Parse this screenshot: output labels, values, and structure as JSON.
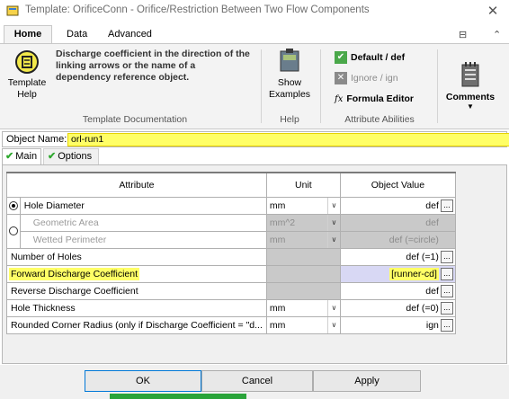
{
  "window": {
    "title": "Template: OrificeConn - Orifice/Restriction Between Two Flow Components"
  },
  "ribbon_tabs": [
    "Home",
    "Data",
    "Advanced"
  ],
  "ribbon": {
    "template_help_label": "Template Help",
    "description": "Discharge coefficient in the direction of the linking arrows or the name of a dependency reference object.",
    "group_template_documentation": "Template Documentation",
    "show_examples_label": "Show Examples",
    "group_help": "Help",
    "default_label": "Default / def",
    "ignore_label": "Ignore / ign",
    "formula_editor_label": "Formula Editor",
    "group_attribute_abilities": "Attribute Abilities",
    "comments_label": "Comments"
  },
  "object_name": {
    "label": "Object Name:",
    "value": "orl-run1"
  },
  "subtabs": [
    "Main",
    "Options"
  ],
  "grid": {
    "headers": [
      "Attribute",
      "Unit",
      "Object Value"
    ],
    "rows": [
      {
        "attribute": "Hole Diameter",
        "unit": "mm",
        "value": "def"
      },
      {
        "attribute": "Geometric Area",
        "unit": "mm^2",
        "value": "def"
      },
      {
        "attribute": "Wetted Perimeter",
        "unit": "mm",
        "value": "def (=circle)"
      },
      {
        "attribute": "Number of Holes",
        "unit": "",
        "value": "def (=1)"
      },
      {
        "attribute": "Forward Discharge Coefficient",
        "unit": "",
        "value": "[runner-cd]"
      },
      {
        "attribute": "Reverse Discharge Coefficient",
        "unit": "",
        "value": "def"
      },
      {
        "attribute": "Hole Thickness",
        "unit": "mm",
        "value": "def (=0)"
      },
      {
        "attribute": "Rounded Corner Radius (only if Discharge Coefficient = \"d...",
        "unit": "mm",
        "value": "ign"
      }
    ]
  },
  "buttons": {
    "ok": "OK",
    "cancel": "Cancel",
    "apply": "Apply"
  }
}
